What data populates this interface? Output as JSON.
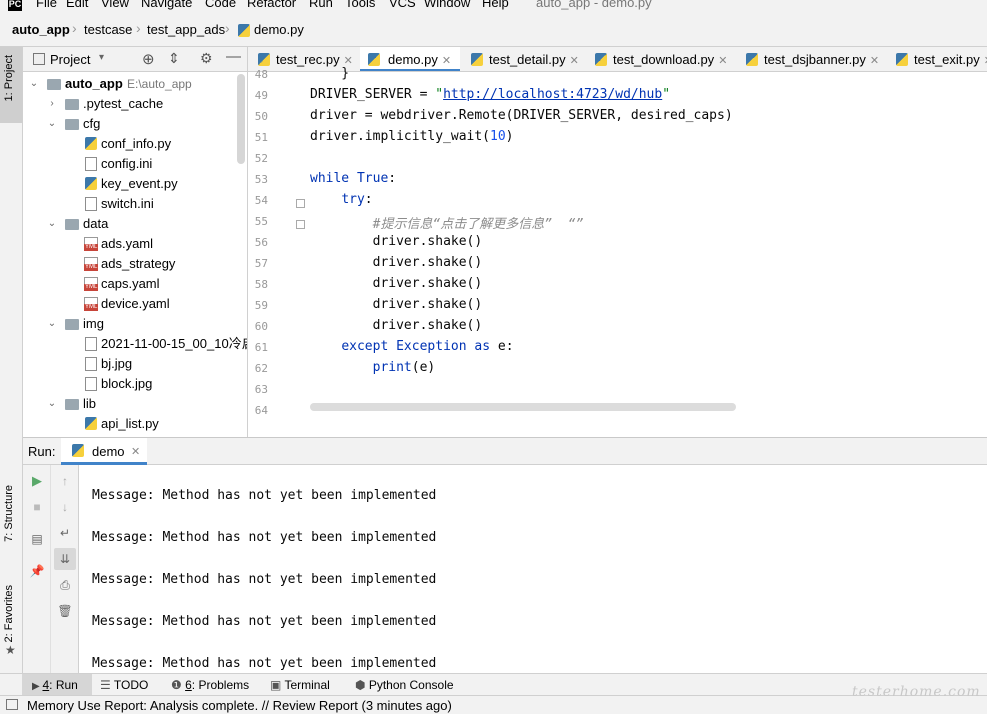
{
  "menu": {
    "items": [
      "File",
      "Edit",
      "View",
      "Navigate",
      "Code",
      "Refactor",
      "Run",
      "Tools",
      "VCS",
      "Window",
      "Help"
    ],
    "window_title": "auto_app - demo.py"
  },
  "breadcrumb": {
    "items": [
      "auto_app",
      "testcase",
      "test_app_ads",
      "demo.py"
    ]
  },
  "left_strip": {
    "project_tab": "1: Project",
    "structure_tab": "7: Structure",
    "favorites_tab": "2: Favorites"
  },
  "project_panel": {
    "title": "Project",
    "tree": [
      {
        "label": "auto_app",
        "path": "E:\\auto_app"
      },
      {
        "label": ".pytest_cache"
      },
      {
        "label": "cfg"
      },
      {
        "label": "conf_info.py"
      },
      {
        "label": "config.ini"
      },
      {
        "label": "key_event.py"
      },
      {
        "label": "switch.ini"
      },
      {
        "label": "data"
      },
      {
        "label": "ads.yaml"
      },
      {
        "label": "ads_strategy"
      },
      {
        "label": "caps.yaml"
      },
      {
        "label": "device.yaml"
      },
      {
        "label": "img"
      },
      {
        "label": "2021-11-00-15_00_10冷启"
      },
      {
        "label": "bj.jpg"
      },
      {
        "label": "block.jpg"
      },
      {
        "label": "lib"
      },
      {
        "label": "api_list.py"
      }
    ]
  },
  "editor": {
    "tabs": [
      "test_rec.py",
      "demo.py",
      "test_detail.py",
      "test_download.py",
      "test_dsjbanner.py",
      "test_exit.py"
    ],
    "active_tab": "demo.py",
    "line_numbers": [
      "48",
      "49",
      "50",
      "51",
      "52",
      "53",
      "54",
      "55",
      "56",
      "57",
      "58",
      "59",
      "60",
      "61",
      "62",
      "63",
      "64"
    ],
    "code": {
      "l48": "    }",
      "l49_a": "DRIVER_SERVER = ",
      "l49_q1": "\"",
      "l49_url": "http://localhost:4723/wd/hub",
      "l49_q2": "\"",
      "l50": "driver = webdriver.Remote(DRIVER_SERVER, desired_caps)",
      "l51_a": "driver.implicitly_wait(",
      "l51_num": "10",
      "l51_b": ")",
      "l53_kw1": "while",
      "l53_kw2": "True",
      "l53_b": ":",
      "l54_kw": "try",
      "l54_b": ":",
      "l55": "#提示信息“点击了解更多信息”  “”",
      "l56": "driver.shake()",
      "l57": "driver.shake()",
      "l58": "driver.shake()",
      "l59": "driver.shake()",
      "l60": "driver.shake()",
      "l61_kw1": "except",
      "l61_exc": "Exception",
      "l61_kw2": "as",
      "l61_b": "e:",
      "l62_kw": "print",
      "l62_b": "(e)"
    }
  },
  "run_panel": {
    "label": "Run:",
    "tab": "demo",
    "console_lines": [
      "Message: Method has not yet been implemented",
      "Message: Method has not yet been implemented",
      "Message: Method has not yet been implemented",
      "Message: Method has not yet been implemented",
      "Message: Method has not yet been implemented"
    ]
  },
  "bottom_tabs": {
    "run_num": "4",
    "run_label": ": Run",
    "todo": "TODO",
    "problems_num": "6",
    "problems_label": ": Problems",
    "terminal": "Terminal",
    "python_console": "Python Console"
  },
  "status_bar": {
    "text": "Memory Use Report: Analysis complete. // Review Report (3 minutes ago)"
  },
  "watermark": "testerhome.com",
  "colors": {
    "keyword": "#0033b3",
    "string": "#067d17",
    "number": "#1750eb",
    "comment": "#8c8c8c",
    "run_green": "#59a869"
  }
}
